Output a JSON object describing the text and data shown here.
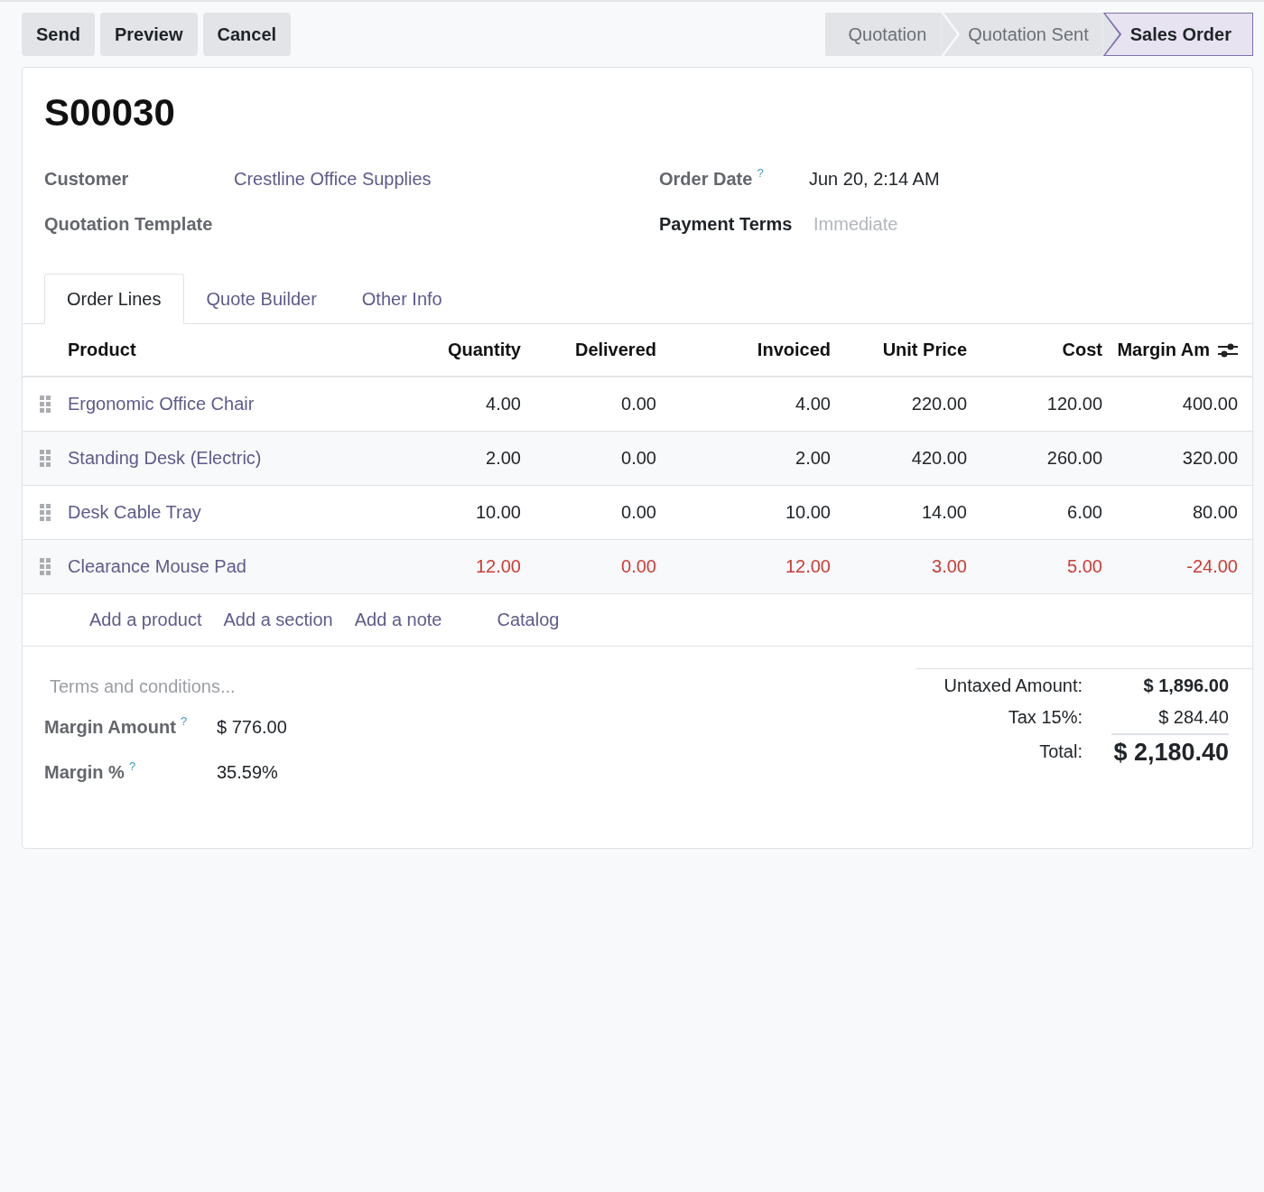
{
  "toolbar": {
    "buttons": [
      "Send",
      "Preview",
      "Cancel"
    ]
  },
  "status_steps": [
    {
      "label": "Quotation",
      "selected": false
    },
    {
      "label": "Quotation Sent",
      "selected": false
    },
    {
      "label": "Sales Order",
      "selected": true
    }
  ],
  "record": {
    "title": "S00030",
    "left_fields": [
      {
        "label": "Customer",
        "kind": "link",
        "value": "Crestline Office Supplies",
        "required": false
      },
      {
        "label": "Quotation Template",
        "kind": "empty",
        "required": false
      }
    ],
    "right_fields": [
      {
        "label": "Order Date",
        "help": "?",
        "kind": "text",
        "value": "Jun 20, 2:14 AM",
        "required": false
      },
      {
        "label": "Payment Terms",
        "kind": "select",
        "placeholder": "Immediate",
        "required": true
      }
    ]
  },
  "tabs": [
    {
      "label": "Order Lines",
      "selected": true
    },
    {
      "label": "Quote Builder",
      "selected": false
    },
    {
      "label": "Other Info",
      "selected": false
    }
  ],
  "table": {
    "columns": [
      "Product",
      "Quantity",
      "Delivered",
      "Invoiced",
      "Unit Price",
      "Cost",
      "Margin Am"
    ],
    "rows": [
      {
        "cells": [
          "Ergonomic Office Chair",
          "4.00",
          "0.00",
          "4.00",
          "220.00",
          "120.00",
          "400.00"
        ],
        "warning": false
      },
      {
        "cells": [
          "Standing Desk (Electric)",
          "2.00",
          "0.00",
          "2.00",
          "420.00",
          "260.00",
          "320.00"
        ],
        "warning": false
      },
      {
        "cells": [
          "Desk Cable Tray",
          "10.00",
          "0.00",
          "10.00",
          "14.00",
          "6.00",
          "80.00"
        ],
        "warning": false
      },
      {
        "cells": [
          "Clearance Mouse Pad",
          "12.00",
          "0.00",
          "12.00",
          "3.00",
          "5.00",
          "-24.00"
        ],
        "warning": true
      }
    ],
    "add_links": [
      "Add a product",
      "Add a section",
      "Add a note"
    ],
    "catalog_button": "Catalog"
  },
  "notes": {
    "placeholder": "Terms and conditions..."
  },
  "margin_fields": [
    {
      "label": "Margin Amount",
      "help": "?",
      "value": "$ 776.00"
    },
    {
      "label": "Margin %",
      "help": "?",
      "value": "35.59%"
    }
  ],
  "totals": [
    {
      "label": "Untaxed Amount:",
      "value": "$ 1,896.00",
      "kind": "subtotal"
    },
    {
      "label": "Tax 15%:",
      "value": "$ 284.40",
      "kind": "tax"
    },
    {
      "label": "Total:",
      "value": "$ 2,180.40",
      "kind": "total"
    }
  ]
}
